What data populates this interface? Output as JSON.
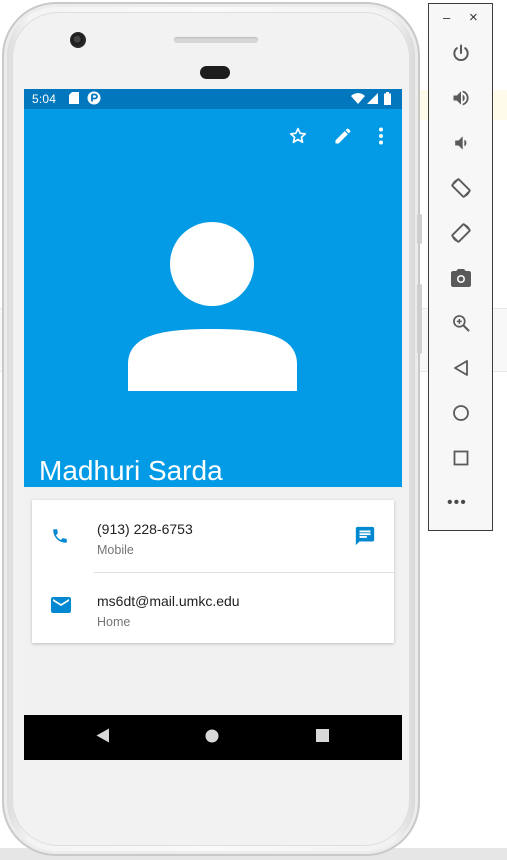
{
  "status_bar": {
    "time": "5:04"
  },
  "contact": {
    "name": "Madhuri Sarda",
    "phone": {
      "number": "(913) 228-6753",
      "type": "Mobile"
    },
    "email": {
      "address": "ms6dt@mail.umkc.edu",
      "type": "Home"
    }
  },
  "toolbar_icons": [
    "star-outline-icon",
    "edit-pencil-icon",
    "more-vert-icon"
  ],
  "nav_icons": [
    "back-triangle-icon",
    "home-circle-icon",
    "recents-square-icon"
  ],
  "emulator": {
    "window_controls": {
      "minimize": "–",
      "close": "×"
    },
    "more_label": "•••",
    "buttons": [
      "power",
      "volume-up",
      "volume-down",
      "rotate-left",
      "rotate-right",
      "screenshot",
      "zoom",
      "back",
      "home",
      "overview"
    ]
  },
  "colors": {
    "header_blue": "#039be5",
    "status_bar_blue": "#0277bd",
    "icon_blue": "#0288d1",
    "emulator_icon": "#5a5a5a"
  }
}
